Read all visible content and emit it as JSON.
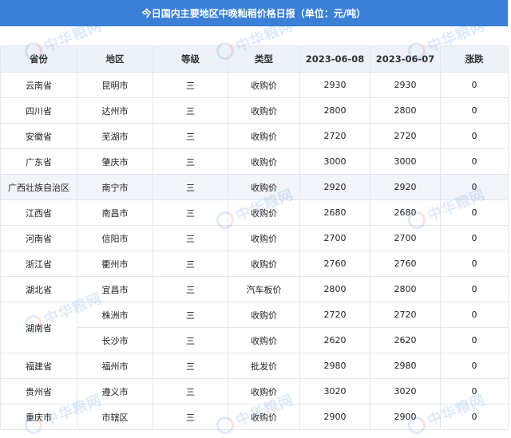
{
  "title": "今日国内主要地区中晚籼稻价格日报（单位：元/吨）",
  "watermark_text": "中华粮网",
  "colors": {
    "header_blue": "#3A80D6",
    "header_row": "#EDF1F8",
    "border": "#e2e6ee"
  },
  "columns": [
    "省份",
    "地区",
    "等级",
    "类型",
    "2023-06-08",
    "2023-06-07",
    "涨跌"
  ],
  "rows": [
    {
      "province": "云南省",
      "region": "昆明市",
      "grade": "三",
      "type": "收购价",
      "p1": "2930",
      "p2": "2930",
      "change": "0"
    },
    {
      "province": "四川省",
      "region": "达州市",
      "grade": "三",
      "type": "收购价",
      "p1": "2800",
      "p2": "2800",
      "change": "0"
    },
    {
      "province": "安徽省",
      "region": "芜湖市",
      "grade": "三",
      "type": "收购价",
      "p1": "2720",
      "p2": "2720",
      "change": "0"
    },
    {
      "province": "广东省",
      "region": "肇庆市",
      "grade": "三",
      "type": "收购价",
      "p1": "3000",
      "p2": "3000",
      "change": "0"
    },
    {
      "province": "广西壮族自治区",
      "region": "南宁市",
      "grade": "三",
      "type": "收购价",
      "p1": "2920",
      "p2": "2920",
      "change": "0"
    },
    {
      "province": "江西省",
      "region": "南昌市",
      "grade": "三",
      "type": "收购价",
      "p1": "2680",
      "p2": "2680",
      "change": "0"
    },
    {
      "province": "河南省",
      "region": "信阳市",
      "grade": "三",
      "type": "收购价",
      "p1": "2700",
      "p2": "2700",
      "change": "0"
    },
    {
      "province": "浙江省",
      "region": "衢州市",
      "grade": "三",
      "type": "收购价",
      "p1": "2760",
      "p2": "2760",
      "change": "0"
    },
    {
      "province": "湖北省",
      "region": "宜昌市",
      "grade": "三",
      "type": "汽车板价",
      "p1": "2800",
      "p2": "2800",
      "change": "0"
    },
    {
      "province": "湖南省",
      "region": "株洲市",
      "grade": "三",
      "type": "收购价",
      "p1": "2720",
      "p2": "2720",
      "change": "0"
    },
    {
      "province": "",
      "region": "长沙市",
      "grade": "三",
      "type": "收购价",
      "p1": "2620",
      "p2": "2620",
      "change": "0"
    },
    {
      "province": "福建省",
      "region": "福州市",
      "grade": "三",
      "type": "批发价",
      "p1": "2980",
      "p2": "2980",
      "change": "0"
    },
    {
      "province": "贵州省",
      "region": "遵义市",
      "grade": "三",
      "type": "收购价",
      "p1": "3020",
      "p2": "3020",
      "change": "0"
    },
    {
      "province": "重庆市",
      "region": "市辖区",
      "grade": "三",
      "type": "收购价",
      "p1": "2900",
      "p2": "2900",
      "change": "0"
    }
  ]
}
